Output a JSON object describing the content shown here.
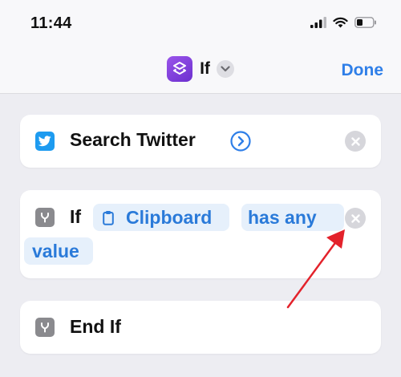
{
  "status_bar": {
    "time": "11:44"
  },
  "nav": {
    "title": "If",
    "done_label": "Done"
  },
  "actions": {
    "search_twitter": {
      "label": "Search Twitter"
    },
    "if_block": {
      "keyword": "If",
      "input_token": "Clipboard",
      "condition_token": "has any",
      "condition_continued": "value"
    },
    "end_if": {
      "label": "End If"
    }
  },
  "colors": {
    "accent": "#2f7fe8",
    "twitter": "#1d9bf0",
    "control_icon": "#8a8a8e",
    "shortcut_icon": "#7b3fe4",
    "annotation_arrow": "#e3222b"
  },
  "icons": [
    "shortcuts-app-icon",
    "chevron-down-icon",
    "twitter-icon",
    "arrow-right-circle-icon",
    "remove-x-icon",
    "branch-icon",
    "clipboard-icon",
    "signal-icon",
    "wifi-icon",
    "battery-icon"
  ]
}
